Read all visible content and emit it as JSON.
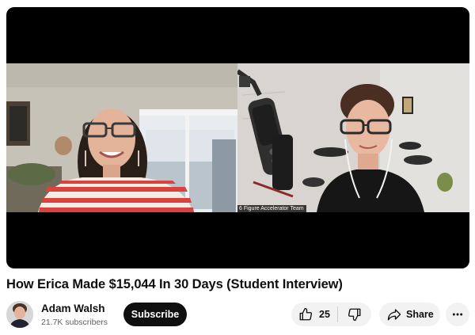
{
  "video": {
    "caption": "6 Figure Accelerator Team",
    "title": "How Erica Made $15,044 In 30 Days (Student Interview)"
  },
  "channel": {
    "name": "Adam Walsh",
    "subscribers": "21.7K subscribers",
    "subscribe_label": "Subscribe"
  },
  "actions": {
    "like_count": "25",
    "share_label": "Share",
    "more_label": "•••"
  },
  "icons": {
    "like": "thumbs-up-icon",
    "dislike": "thumbs-down-icon",
    "share": "share-arrow-icon",
    "more": "more-horizontal-icon"
  },
  "colors": {
    "subscribe_bg": "#0f0f0f",
    "pill_bg": "#f2f2f2",
    "text": "#0f0f0f",
    "secondary_text": "#606060"
  }
}
